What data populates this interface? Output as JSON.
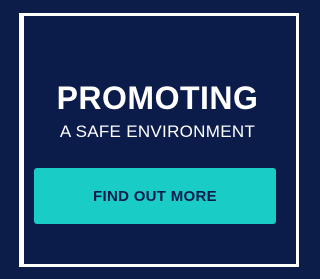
{
  "banner": {
    "headline": "PROMOTING",
    "subheadline": "A SAFE ENVIRONMENT",
    "cta_label": "FIND OUT MORE"
  },
  "colors": {
    "background": "#0b1c4b",
    "accent": "#19ccc5",
    "text": "#ffffff",
    "cta_text": "#0b1c4b"
  }
}
